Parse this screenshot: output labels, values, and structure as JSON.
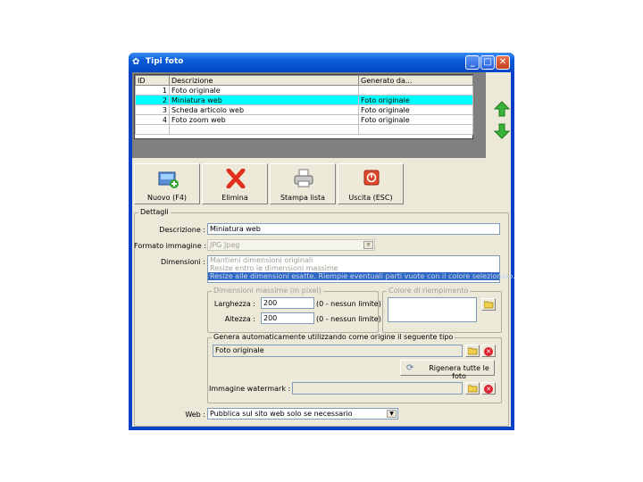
{
  "window": {
    "title": "Tipi foto"
  },
  "table": {
    "columns": [
      "ID",
      "Descrizione",
      "Generato da..."
    ],
    "rows": [
      {
        "id": "1",
        "descrizione": "Foto originale",
        "generato": ""
      },
      {
        "id": "2",
        "descrizione": "Miniatura web",
        "generato": "Foto originale"
      },
      {
        "id": "3",
        "descrizione": "Scheda articolo web",
        "generato": "Foto originale"
      },
      {
        "id": "4",
        "descrizione": "Foto zoom web",
        "generato": "Foto originale"
      }
    ],
    "selected_index": 1
  },
  "toolbar": {
    "nuovo": "Nuovo (F4)",
    "elimina": "Elimina",
    "stampa": "Stampa lista",
    "uscita": "Uscita (ESC)"
  },
  "details": {
    "group_label": "Dettagli",
    "descrizione_label": "Descrizione :",
    "descrizione_value": "Miniatura web",
    "formato_label": "Formato immagine :",
    "formato_value": "JPG Jpeg",
    "dimensioni_label": "Dimensioni :",
    "dimensioni_options": [
      "Mantieni dimensioni originali",
      "Resize entro le dimensioni massime",
      "Resize alle dimensioni esatte. Riempie eventuali parti vuote con il colore selezionato."
    ],
    "dimensioni_selected": 2,
    "dim_max_label": "Dimensioni massime (in pixel)",
    "larghezza_label": "Larghezza :",
    "larghezza_value": "200",
    "altezza_label": "Altezza :",
    "altezza_value": "200",
    "nessun_limite": "(0 - nessun limite)",
    "colore_label": "Colore di riempimento",
    "genera_label": "Genera automaticamente utilizzando come origine il seguente tipo",
    "origine_value": "Foto originale",
    "rigenera_label": "Rigenera tutte le foto",
    "watermark_label": "Immagine watermark :",
    "watermark_value": "",
    "web_label": "Web :",
    "web_value": "Pubblica sul sito web solo se necessario"
  },
  "colors": {
    "selection": "#00ffff",
    "titlebar": "#0a5bd9",
    "list_selection": "#316ac5"
  }
}
